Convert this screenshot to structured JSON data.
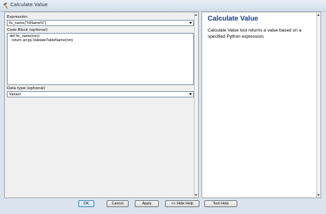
{
  "window": {
    "title": "Calculate Value"
  },
  "form": {
    "expression": {
      "label": "Expression",
      "value": "fix_name(\"%Name%\")"
    },
    "code_block": {
      "label": "Code Block (optional)",
      "lines": [
        "def fix_name(nm):",
        "  return arcpy.ValidateTableName(nm)"
      ]
    },
    "data_type": {
      "label": "Data type (optional)",
      "value": "Variant"
    }
  },
  "help": {
    "title": "Calculate Value",
    "text": "Calculate Value tool returns a value based on a specified Python expression."
  },
  "buttons": {
    "ok": "OK",
    "cancel": "Cancel",
    "apply": "Apply",
    "hide_help": "<< Hide Help",
    "tool_help": "Tool Help"
  },
  "colors": {
    "background": "#dbe4ee",
    "help_title": "#193d7c",
    "panel_border": "#a0a0a0"
  }
}
